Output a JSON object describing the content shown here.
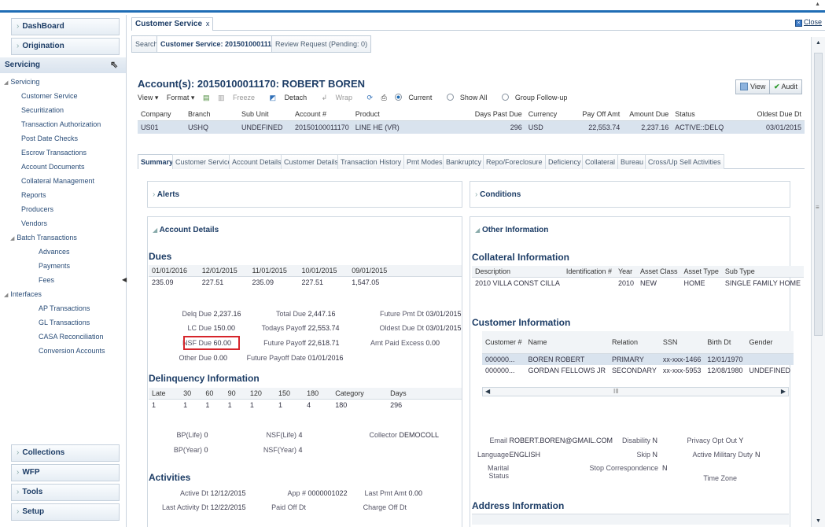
{
  "sidebar": {
    "dashboard": "DashBoard",
    "origination": "Origination",
    "servicing": "Servicing",
    "tree": [
      {
        "label": "Servicing",
        "level": "l1"
      },
      {
        "label": "Customer Service",
        "level": "l2"
      },
      {
        "label": "Securitization",
        "level": "l2"
      },
      {
        "label": "Transaction Authorization",
        "level": "l2"
      },
      {
        "label": "Post Date Checks",
        "level": "l2"
      },
      {
        "label": "Escrow Transactions",
        "level": "l2"
      },
      {
        "label": "Account Documents",
        "level": "l2"
      },
      {
        "label": "Collateral Management",
        "level": "l2"
      },
      {
        "label": "Reports",
        "level": "l2"
      },
      {
        "label": "Producers",
        "level": "l2"
      },
      {
        "label": "Vendors",
        "level": "l2"
      },
      {
        "label": "Batch Transactions",
        "level": "l2b"
      },
      {
        "label": "Advances",
        "level": "l3"
      },
      {
        "label": "Payments",
        "level": "l3"
      },
      {
        "label": "Fees",
        "level": "l3"
      },
      {
        "label": "Interfaces",
        "level": "l1"
      },
      {
        "label": "AP Transactions",
        "level": "l3"
      },
      {
        "label": "GL Transactions",
        "level": "l3"
      },
      {
        "label": "CASA Reconciliation",
        "level": "l3"
      },
      {
        "label": "Conversion Accounts",
        "level": "l3"
      }
    ],
    "collections": "Collections",
    "wfp": "WFP",
    "tools": "Tools",
    "setup": "Setup"
  },
  "header": {
    "tab_title": "Customer Service",
    "tab_close": "x",
    "close_label": "Close"
  },
  "subtabs": [
    "Search",
    "Customer Service: 20150100011170",
    "Review Request (Pending: 0)"
  ],
  "account": {
    "title": "Account(s): 20150100011170: ROBERT BOREN",
    "view_label": "View",
    "audit_label": "Audit"
  },
  "toolbar": {
    "view": "View ▾",
    "format": "Format ▾",
    "freeze": "Freeze",
    "detach": "Detach",
    "wrap": "Wrap",
    "current": "Current",
    "show_all": "Show All",
    "group_followup": "Group Follow-up"
  },
  "acct_table": {
    "headers": [
      "Company",
      "Branch",
      "Sub Unit",
      "Account #",
      "Product",
      "Days Past Due",
      "Currency",
      "Pay Off Amt",
      "Amount Due",
      "Status",
      "Oldest Due Dt"
    ],
    "row": [
      "US01",
      "USHQ",
      "UNDEFINED",
      "20150100011170",
      "LINE HE (VR)",
      "296",
      "USD",
      "22,553.74",
      "2,237.16",
      "ACTIVE::DELQ",
      "03/01/2015"
    ]
  },
  "detail_tabs": [
    "Summary",
    "Customer Service",
    "Account Details",
    "Customer Details",
    "Transaction History",
    "Pmt Modes",
    "Bankruptcy",
    "Repo/Foreclosure",
    "Deficiency",
    "Collateral",
    "Bureau",
    "Cross/Up Sell Activities"
  ],
  "alerts": "Alerts",
  "conditions": "Conditions",
  "account_details_title": "Account Details",
  "other_info_title": "Other Information",
  "dues": {
    "title": "Dues",
    "headers": [
      "01/01/2016",
      "12/01/2015",
      "11/01/2015",
      "10/01/2015",
      "09/01/2015"
    ],
    "values": [
      "235.09",
      "227.51",
      "235.09",
      "227.51",
      "1,547.05"
    ]
  },
  "summary": {
    "delq_due_k": "Delq Due",
    "delq_due_v": "2,237.16",
    "lc_due_k": "LC Due",
    "lc_due_v": "150.00",
    "nsf_due_k": "NSF Due",
    "nsf_due_v": "60.00",
    "other_due_k": "Other Due",
    "other_due_v": "0.00",
    "total_due_k": "Total Due",
    "total_due_v": "2,447.16",
    "todays_payoff_k": "Todays Payoff",
    "todays_payoff_v": "22,553.74",
    "future_payoff_k": "Future Payoff",
    "future_payoff_v": "22,618.71",
    "future_payoff_date_k": "Future Payoff Date",
    "future_payoff_date_v": "01/01/2016",
    "future_pmt_dt_k": "Future Pmt Dt",
    "future_pmt_dt_v": "03/01/2015",
    "oldest_due_dt_k": "Oldest Due Dt",
    "oldest_due_dt_v": "03/01/2015",
    "amt_paid_excess_k": "Amt Paid Excess",
    "amt_paid_excess_v": "0.00"
  },
  "delinquency": {
    "title": "Delinquency Information",
    "headers": [
      "Late",
      "30",
      "60",
      "90",
      "120",
      "150",
      "180",
      "Category",
      "Days"
    ],
    "values": [
      "1",
      "1",
      "1",
      "1",
      "1",
      "1",
      "4",
      "180",
      "296"
    ]
  },
  "bp": {
    "bp_life_k": "BP(Life)",
    "bp_life_v": "0",
    "bp_year_k": "BP(Year)",
    "bp_year_v": "0",
    "nsf_life_k": "NSF(Life)",
    "nsf_life_v": "4",
    "nsf_year_k": "NSF(Year)",
    "nsf_year_v": "4",
    "collector_k": "Collector",
    "collector_v": "DEMOCOLL"
  },
  "activities": {
    "title": "Activities",
    "active_dt_k": "Active Dt",
    "active_dt_v": "12/12/2015",
    "last_activity_dt_k": "Last Activity Dt",
    "last_activity_dt_v": "12/22/2015",
    "app_k": "App #",
    "app_v": "0000001022",
    "paid_off_dt_k": "Paid Off Dt",
    "paid_off_dt_v": "",
    "last_pmt_amt_k": "Last Pmt Amt",
    "last_pmt_amt_v": "0.00",
    "charge_off_dt_k": "Charge Off Dt",
    "charge_off_dt_v": ""
  },
  "collateral": {
    "title": "Collateral Information",
    "headers": [
      "Description",
      "Identification #",
      "Year",
      "Asset Class",
      "Asset Type",
      "Sub Type"
    ],
    "row": [
      "2010 VILLA CONST CILLA",
      "",
      "2010",
      "NEW",
      "HOME",
      "SINGLE FAMILY HOME"
    ]
  },
  "customer": {
    "title": "Customer Information",
    "headers": [
      "Customer #",
      "Name",
      "Relation",
      "SSN",
      "Birth Dt",
      "Gender"
    ],
    "rows": [
      [
        "000000...",
        "BOREN ROBERT",
        "PRIMARY",
        "xx-xxx-1466",
        "12/01/1970",
        ""
      ],
      [
        "000000...",
        "GORDAN FELLOWS JR",
        "SECONDARY",
        "xx-xxx-5953",
        "12/08/1980",
        "UNDEFINED"
      ]
    ],
    "scroll_grip": "III"
  },
  "contact": {
    "email_k": "Email",
    "email_v": "ROBERT.BOREN@GMAIL.COM",
    "language_k": "Language",
    "language_v": "ENGLISH",
    "marital_k": "Marital Status",
    "marital_v": "",
    "disability_k": "Disability",
    "disability_v": "N",
    "skip_k": "Skip",
    "skip_v": "N",
    "stop_k": "Stop Correspondence",
    "stop_v": "N",
    "privacy_k": "Privacy Opt Out",
    "privacy_v": "Y",
    "military_k": "Active Military Duty",
    "military_v": "N",
    "timezone_k": "Time Zone",
    "timezone_v": ""
  },
  "address_title": "Address Information"
}
